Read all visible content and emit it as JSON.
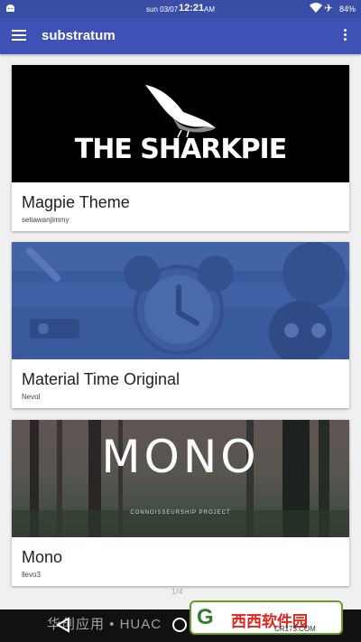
{
  "status_bar": {
    "date": "sun 03/07",
    "time": "12:21",
    "ampm": "AM",
    "battery": "84%"
  },
  "app_bar": {
    "title": "substratum"
  },
  "themes": [
    {
      "name": "Magpie Theme",
      "author": "setiawanjimmy",
      "banner_text": "THE SHARKPIE"
    },
    {
      "name": "Material Time Original",
      "author": "Nevol"
    },
    {
      "name": "Mono",
      "author": "llevo3",
      "banner_text": "MONO",
      "banner_subtext": "CONNOISSEURSHIP PROJECT"
    }
  ],
  "page_indicator": "1/4",
  "watermark": "华创应用 • HUAC",
  "site_logo": {
    "mark": "G",
    "text": "西西软件园",
    "url": "CR173.COM"
  },
  "colors": {
    "primary": "#3f51b5",
    "status_bar": "#3a4ea8",
    "card": "#ffffff",
    "background": "#f0f0f0"
  }
}
